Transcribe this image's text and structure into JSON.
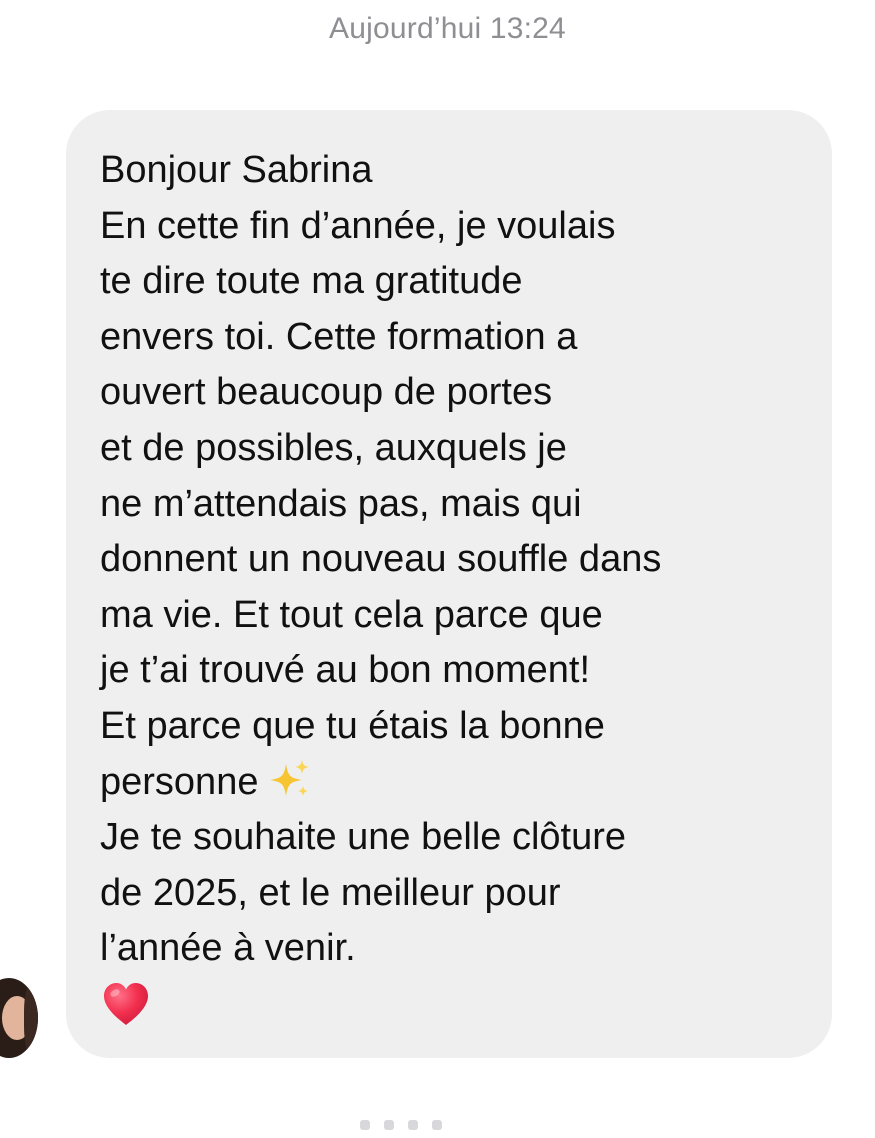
{
  "conversation": {
    "timestamp": "Aujourd’hui 13:24"
  },
  "message": {
    "lines": [
      "Bonjour Sabrina",
      "En cette fin d’année, je voulais",
      "te dire toute ma gratitude",
      "envers toi. Cette formation a",
      "ouvert beaucoup de portes",
      "et de possibles, auxquels je",
      "ne m’attendais pas, mais qui",
      "donnent un nouveau souffle dans",
      "ma vie. Et tout cela parce que",
      "je t’ai trouvé au bon moment!",
      "Et parce que tu étais la bonne",
      "personne",
      "Je te souhaite une belle clôture",
      "de 2025, et le meilleur pour",
      "l’année à venir."
    ],
    "emoji_after_line_12": "sparkles-emoji",
    "final_emoji": "red-heart-emoji"
  },
  "colors": {
    "bubble_background": "#efeff0",
    "timestamp_text": "#8e8e93",
    "message_text": "#111111",
    "heart": "#f2304f",
    "sparkles": "#f7c531"
  }
}
